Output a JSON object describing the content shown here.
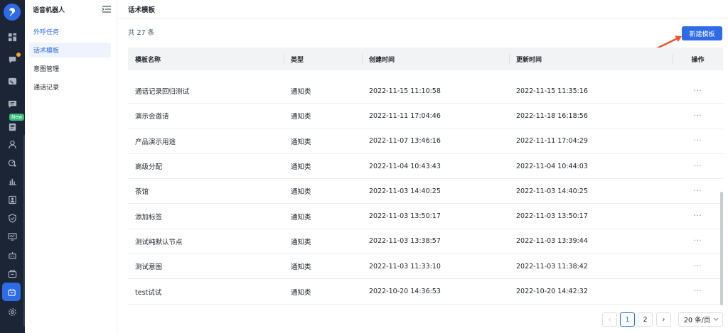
{
  "rail": {
    "items": [
      {
        "icon": "dashboard-icon"
      },
      {
        "icon": "chat-bubble-icon",
        "badge_dot": true
      },
      {
        "icon": "phone-icon"
      },
      {
        "icon": "message-icon"
      },
      {
        "icon": "document-icon",
        "tag": "New"
      },
      {
        "icon": "user-icon"
      },
      {
        "icon": "analytics-icon"
      },
      {
        "icon": "bar-chart-icon"
      },
      {
        "icon": "contacts-icon"
      },
      {
        "icon": "shield-icon"
      },
      {
        "icon": "monitor-icon"
      },
      {
        "icon": "robot-icon"
      },
      {
        "icon": "box-icon"
      },
      {
        "icon": "voice-robot-icon",
        "active": true
      },
      {
        "icon": "settings-icon"
      }
    ],
    "new_tag": "New"
  },
  "submenu": {
    "title": "语音机器人",
    "items": [
      {
        "label": "外呼任务"
      },
      {
        "label": "话术模板"
      },
      {
        "label": "意图管理"
      },
      {
        "label": "通话记录"
      }
    ]
  },
  "page": {
    "title": "话术模板",
    "total": "共 27 条",
    "new_button": "新建模板"
  },
  "table": {
    "headers": [
      "模板名称",
      "类型",
      "创建时间",
      "更新时间",
      "操作"
    ],
    "rows": [
      {
        "name": "通话记录回归测试",
        "type": "通知类",
        "created": "2022-11-15 11:10:58",
        "updated": "2022-11-15 11:35:16",
        "action": "···"
      },
      {
        "name": "演示会邀请",
        "type": "通知类",
        "created": "2022-11-11 17:04:46",
        "updated": "2022-11-18 16:18:56",
        "action": "···"
      },
      {
        "name": "产品演示用途",
        "type": "通知类",
        "created": "2022-11-07 13:46:16",
        "updated": "2022-11-11 17:04:29",
        "action": "···"
      },
      {
        "name": "高级分配",
        "type": "通知类",
        "created": "2022-11-04 10:43:43",
        "updated": "2022-11-04 10:44:03",
        "action": "···"
      },
      {
        "name": "茶馆",
        "type": "通知类",
        "created": "2022-11-03 14:40:25",
        "updated": "2022-11-03 14:40:25",
        "action": "···"
      },
      {
        "name": "添加标签",
        "type": "通知类",
        "created": "2022-11-03 13:50:17",
        "updated": "2022-11-03 13:50:17",
        "action": "···"
      },
      {
        "name": "测试纯默认节点",
        "type": "通知类",
        "created": "2022-11-03 13:38:57",
        "updated": "2022-11-03 13:39:44",
        "action": "···"
      },
      {
        "name": "测试意图",
        "type": "通知类",
        "created": "2022-11-03 11:33:10",
        "updated": "2022-11-03 11:38:42",
        "action": "···"
      },
      {
        "name": "test试试",
        "type": "通知类",
        "created": "2022-10-20 14:36:53",
        "updated": "2022-10-20 14:42:32",
        "action": "···"
      }
    ]
  },
  "pagination": {
    "prev": "‹",
    "pages": [
      "1",
      "2"
    ],
    "current": "1",
    "next": "›",
    "page_size": "20 条/页",
    "page_size_icon": "chevron-down-icon"
  },
  "colors": {
    "accent": "#2e6be6",
    "rail_bg": "#1c2536",
    "annotation_arrow": "#e8552f"
  }
}
